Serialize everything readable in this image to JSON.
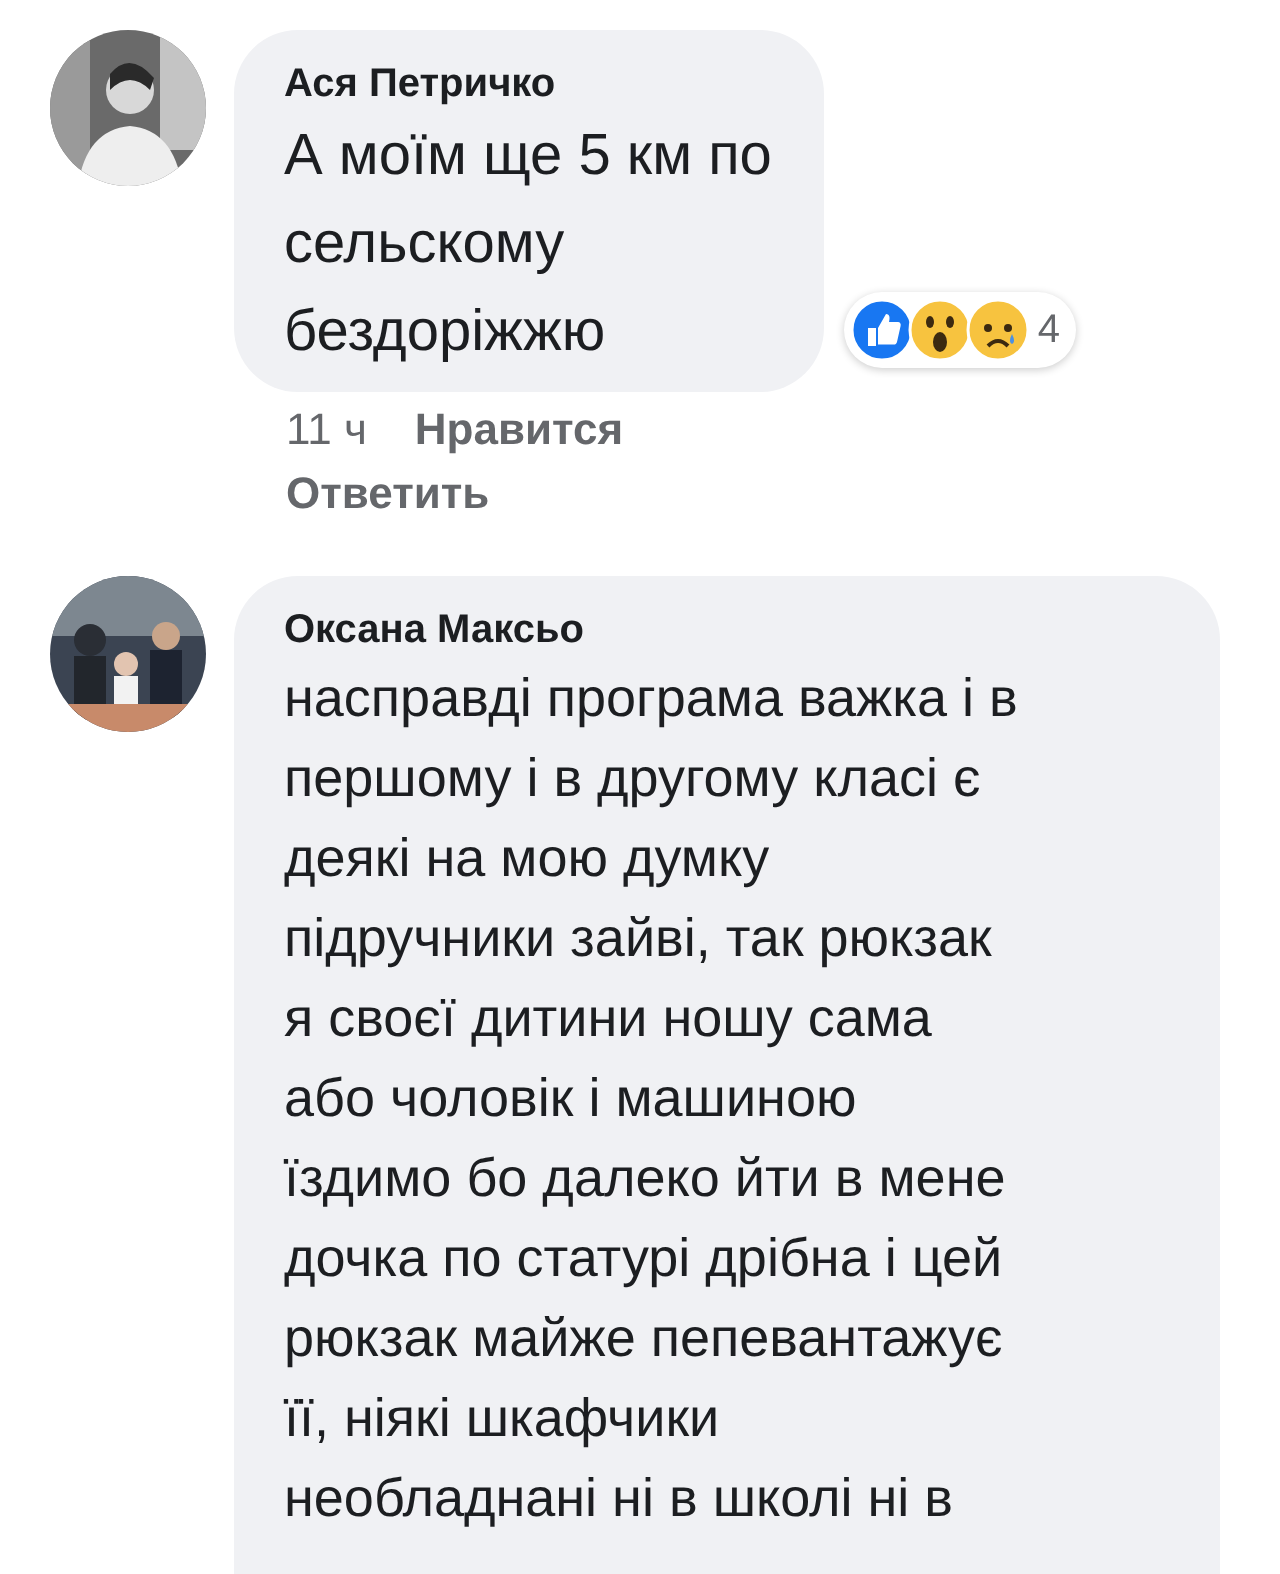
{
  "comments": [
    {
      "author": "Ася Петричко",
      "avatar": {
        "kind": "picture"
      },
      "lines": [
        "А моїм ще 5 км по",
        "сельскому",
        "бездоріжжю"
      ],
      "reactions": {
        "items": [
          {
            "kind": "like"
          },
          {
            "kind": "wow"
          },
          {
            "kind": "sad"
          }
        ],
        "count": "4"
      },
      "time": "11 ч",
      "actions": [
        "Нравится",
        "Ответить"
      ]
    },
    {
      "author": "Оксана Максьо",
      "avatar": {
        "kind": "picture"
      },
      "lines": [
        "насправді програма важка і в",
        "першому і в другому класі є",
        "деякі на мою думку",
        "підручники зайві, так рюкзак",
        "я своєї дитини ношу сама",
        "або чоловік і машиною",
        "їздимо бо далеко  йти в мене",
        "дочка по статурі дрібна і цей",
        "рюкзак майже пепевантажує",
        "її, ніякі шкафчики",
        "необладнані ні в школі ні в"
      ]
    }
  ]
}
